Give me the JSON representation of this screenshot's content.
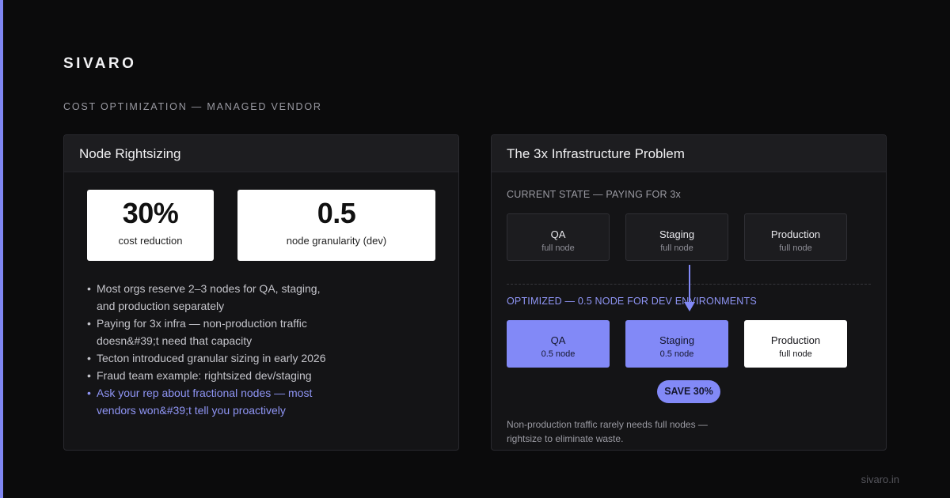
{
  "brand": "SIVARO",
  "subtitle": "COST OPTIMIZATION — MANAGED VENDOR",
  "left_card": {
    "title": "Node Rightsizing",
    "stats": [
      {
        "value": "30%",
        "label": "cost reduction"
      },
      {
        "value": "0.5",
        "label": "node granularity (dev)"
      }
    ],
    "bullets": [
      "Most orgs reserve 2–3 nodes for QA, staging, and production separately",
      "Paying for 3x infra — non-production traffic doesn&#39;t need that capacity",
      "Tecton introduced granular sizing in early 2026",
      "Fraud team example: rightsized dev/staging",
      "Ask your rep about fractional nodes — most vendors won&#39;t tell you proactively"
    ]
  },
  "right_card": {
    "title": "The 3x Infrastructure Problem",
    "current_label": "CURRENT STATE — PAYING FOR 3x",
    "current": [
      {
        "name": "QA",
        "size": "full node"
      },
      {
        "name": "Staging",
        "size": "full node"
      },
      {
        "name": "Production",
        "size": "full node"
      }
    ],
    "optimized_label": "OPTIMIZED — 0.5 NODE FOR DEV ENVIRONMENTS",
    "optimized": [
      {
        "name": "QA",
        "size": "0.5 node"
      },
      {
        "name": "Staging",
        "size": "0.5 node"
      },
      {
        "name": "Production",
        "size": "full node"
      }
    ],
    "badge": "SAVE 30%",
    "footnote": "Non-production traffic rarely needs full nodes — rightsize to eliminate waste."
  },
  "footer": {
    "site": "sivaro.in"
  },
  "colors": {
    "accent": "#7f86f2",
    "background": "#0b0b0c",
    "card": "#141416",
    "card_header": "#1d1d20"
  }
}
